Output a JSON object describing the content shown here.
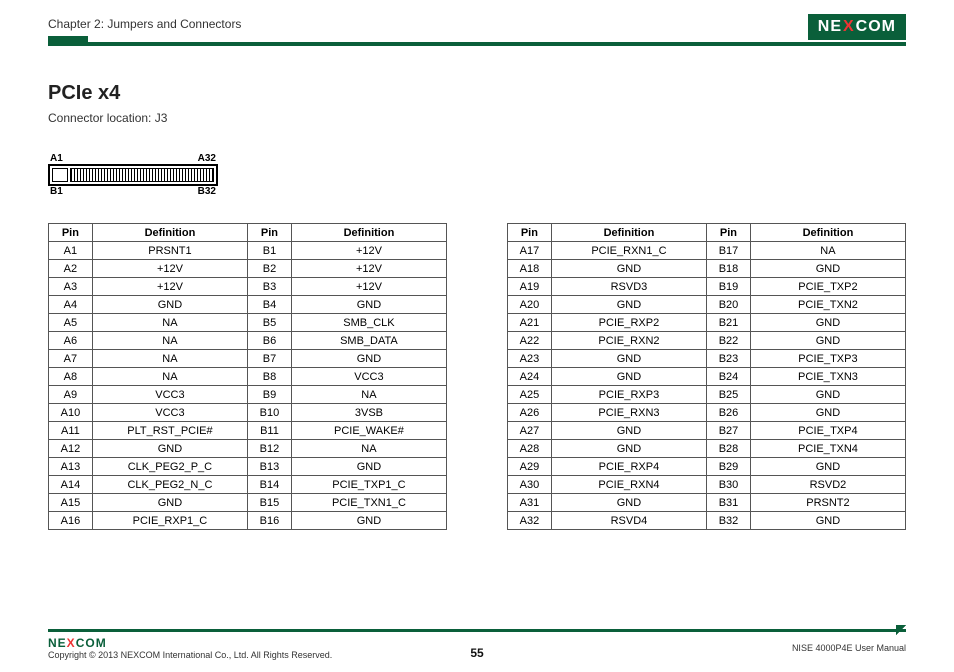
{
  "header": {
    "chapter": "Chapter 2: Jumpers and Connectors",
    "logo_left": "NE",
    "logo_x": "X",
    "logo_right": "COM"
  },
  "title": "PCIe x4",
  "subtitle": "Connector location: J3",
  "diagram": {
    "a1": "A1",
    "a32": "A32",
    "b1": "B1",
    "b32": "B32"
  },
  "table_headers": {
    "pin": "Pin",
    "def": "Definition"
  },
  "table1": [
    {
      "ap": "A1",
      "ad": "PRSNT1",
      "bp": "B1",
      "bd": "+12V"
    },
    {
      "ap": "A2",
      "ad": "+12V",
      "bp": "B2",
      "bd": "+12V"
    },
    {
      "ap": "A3",
      "ad": "+12V",
      "bp": "B3",
      "bd": "+12V"
    },
    {
      "ap": "A4",
      "ad": "GND",
      "bp": "B4",
      "bd": "GND"
    },
    {
      "ap": "A5",
      "ad": "NA",
      "bp": "B5",
      "bd": "SMB_CLK"
    },
    {
      "ap": "A6",
      "ad": "NA",
      "bp": "B6",
      "bd": "SMB_DATA"
    },
    {
      "ap": "A7",
      "ad": "NA",
      "bp": "B7",
      "bd": "GND"
    },
    {
      "ap": "A8",
      "ad": "NA",
      "bp": "B8",
      "bd": "VCC3"
    },
    {
      "ap": "A9",
      "ad": "VCC3",
      "bp": "B9",
      "bd": "NA"
    },
    {
      "ap": "A10",
      "ad": "VCC3",
      "bp": "B10",
      "bd": "3VSB"
    },
    {
      "ap": "A11",
      "ad": "PLT_RST_PCIE#",
      "bp": "B11",
      "bd": "PCIE_WAKE#"
    },
    {
      "ap": "A12",
      "ad": "GND",
      "bp": "B12",
      "bd": "NA"
    },
    {
      "ap": "A13",
      "ad": "CLK_PEG2_P_C",
      "bp": "B13",
      "bd": "GND"
    },
    {
      "ap": "A14",
      "ad": "CLK_PEG2_N_C",
      "bp": "B14",
      "bd": "PCIE_TXP1_C"
    },
    {
      "ap": "A15",
      "ad": "GND",
      "bp": "B15",
      "bd": "PCIE_TXN1_C"
    },
    {
      "ap": "A16",
      "ad": "PCIE_RXP1_C",
      "bp": "B16",
      "bd": "GND"
    }
  ],
  "table2": [
    {
      "ap": "A17",
      "ad": "PCIE_RXN1_C",
      "bp": "B17",
      "bd": "NA"
    },
    {
      "ap": "A18",
      "ad": "GND",
      "bp": "B18",
      "bd": "GND"
    },
    {
      "ap": "A19",
      "ad": "RSVD3",
      "bp": "B19",
      "bd": "PCIE_TXP2"
    },
    {
      "ap": "A20",
      "ad": "GND",
      "bp": "B20",
      "bd": "PCIE_TXN2"
    },
    {
      "ap": "A21",
      "ad": "PCIE_RXP2",
      "bp": "B21",
      "bd": "GND"
    },
    {
      "ap": "A22",
      "ad": "PCIE_RXN2",
      "bp": "B22",
      "bd": "GND"
    },
    {
      "ap": "A23",
      "ad": "GND",
      "bp": "B23",
      "bd": "PCIE_TXP3"
    },
    {
      "ap": "A24",
      "ad": "GND",
      "bp": "B24",
      "bd": "PCIE_TXN3"
    },
    {
      "ap": "A25",
      "ad": "PCIE_RXP3",
      "bp": "B25",
      "bd": "GND"
    },
    {
      "ap": "A26",
      "ad": "PCIE_RXN3",
      "bp": "B26",
      "bd": "GND"
    },
    {
      "ap": "A27",
      "ad": "GND",
      "bp": "B27",
      "bd": "PCIE_TXP4"
    },
    {
      "ap": "A28",
      "ad": "GND",
      "bp": "B28",
      "bd": "PCIE_TXN4"
    },
    {
      "ap": "A29",
      "ad": "PCIE_RXP4",
      "bp": "B29",
      "bd": "GND"
    },
    {
      "ap": "A30",
      "ad": "PCIE_RXN4",
      "bp": "B30",
      "bd": "RSVD2"
    },
    {
      "ap": "A31",
      "ad": "GND",
      "bp": "B31",
      "bd": "PRSNT2"
    },
    {
      "ap": "A32",
      "ad": "RSVD4",
      "bp": "B32",
      "bd": "GND"
    }
  ],
  "footer": {
    "copyright": "Copyright © 2013 NEXCOM International Co., Ltd. All Rights Reserved.",
    "page": "55",
    "manual": "NISE 4000P4E User Manual"
  }
}
